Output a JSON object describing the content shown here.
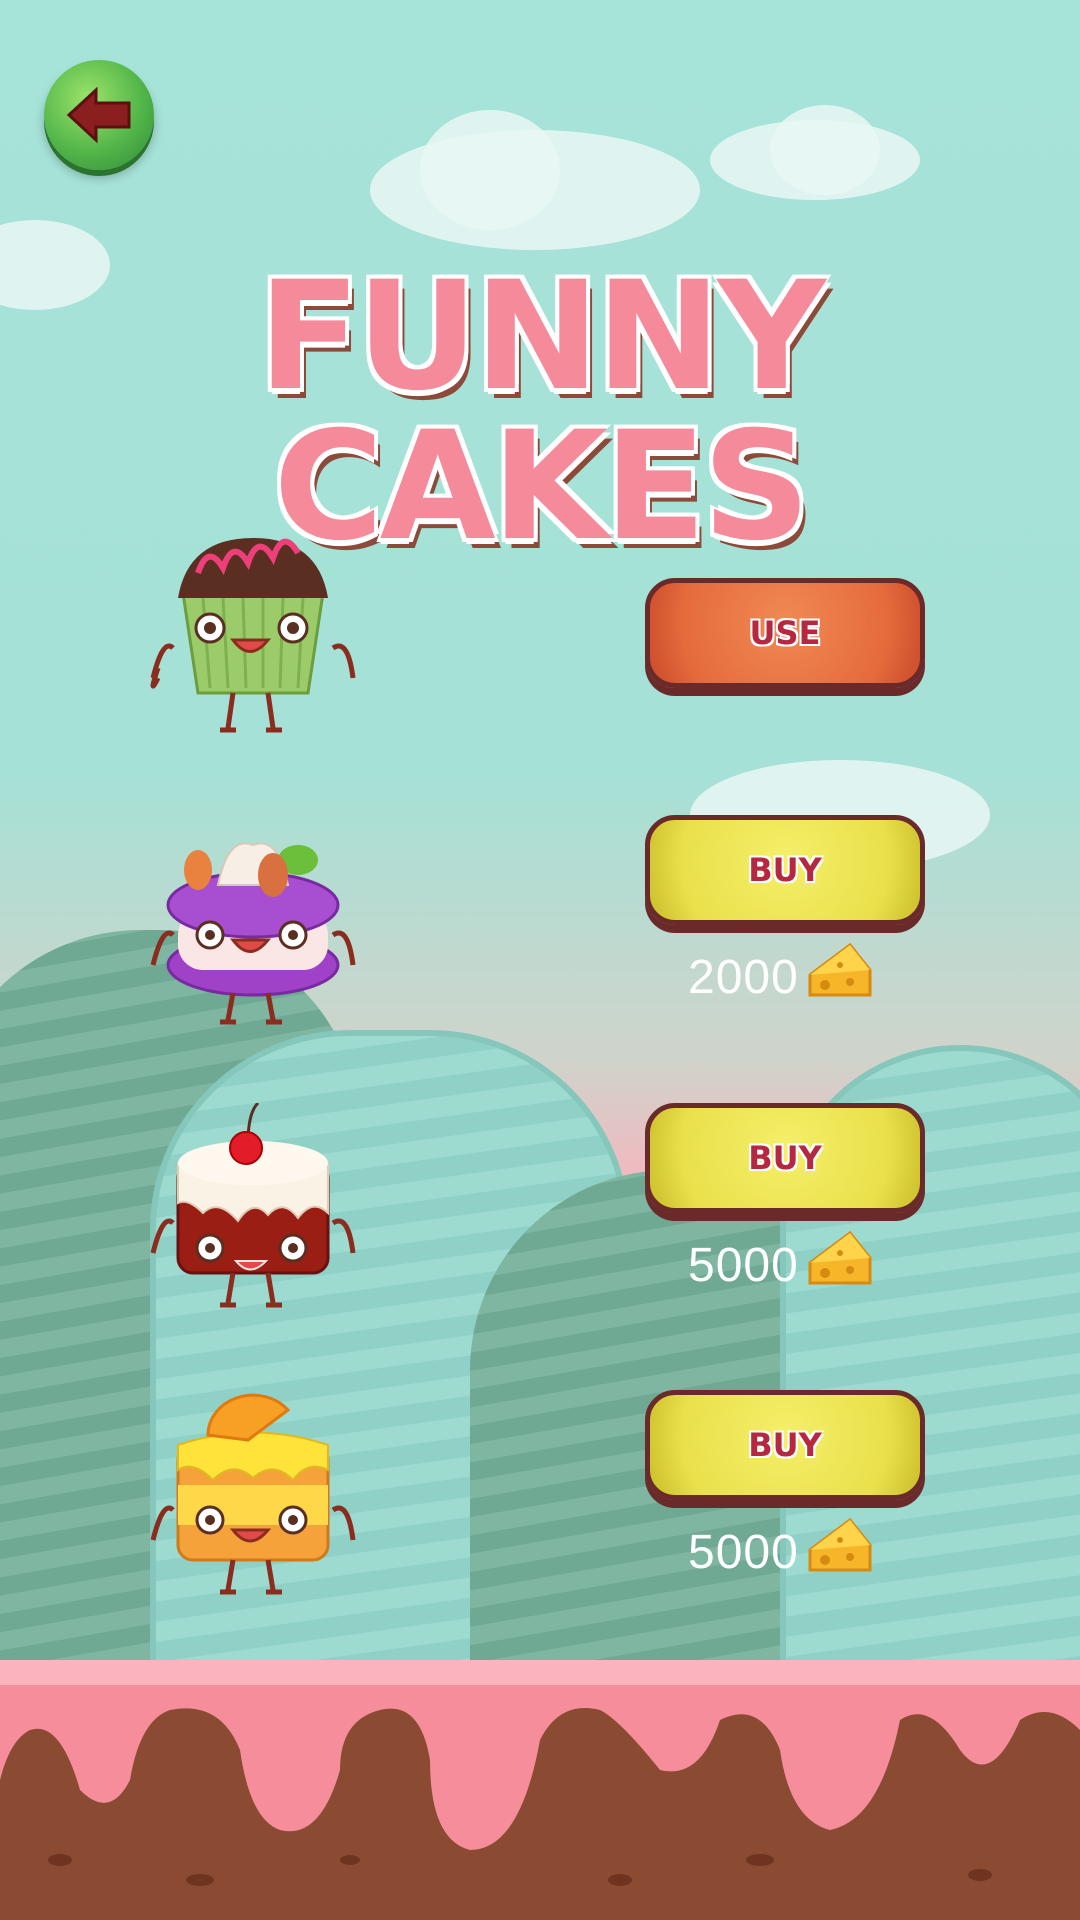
{
  "title": "FUNNY CAKES",
  "back_button": {
    "icon": "back-arrow-icon"
  },
  "items": [
    {
      "name": "chocolate-cupcake",
      "action": "USE",
      "price": null
    },
    {
      "name": "purple-macaron",
      "action": "BUY",
      "price": "2000"
    },
    {
      "name": "cherry-cake",
      "action": "BUY",
      "price": "5000"
    },
    {
      "name": "orange-cake",
      "action": "BUY",
      "price": "5000"
    }
  ],
  "colors": {
    "title": "#f48a9a",
    "use_button": "#e56a3c",
    "buy_button": "#e9e04a",
    "button_text": "#b5283f"
  }
}
